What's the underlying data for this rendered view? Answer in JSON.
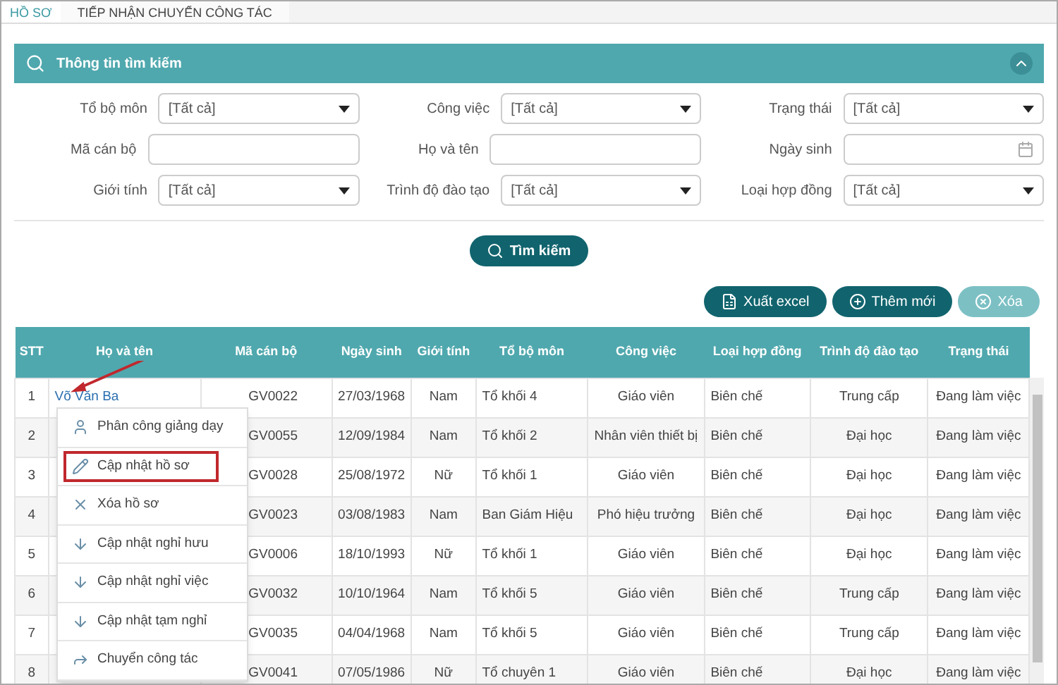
{
  "tabs": [
    {
      "label": "HỒ SƠ",
      "selected": true
    },
    {
      "label": "TIẾP NHẬN CHUYỂN CÔNG TÁC",
      "selected": false
    }
  ],
  "search_panel": {
    "title": "Thông tin tìm kiếm",
    "fields": [
      {
        "label": "Tổ bộ môn",
        "kind": "select",
        "value": "[Tất cả]"
      },
      {
        "label": "Công việc",
        "kind": "select",
        "value": "[Tất cả]"
      },
      {
        "label": "Trạng thái",
        "kind": "select",
        "value": "[Tất cả]"
      },
      {
        "label": "Mã cán bộ",
        "kind": "text"
      },
      {
        "label": "Họ và tên",
        "kind": "text"
      },
      {
        "label": "Ngày sinh",
        "kind": "date"
      },
      {
        "label": "Giới tính",
        "kind": "select",
        "value": "[Tất cả]"
      },
      {
        "label": "Trình độ đào tạo",
        "kind": "select",
        "value": "[Tất cả]"
      },
      {
        "label": "Loại hợp đồng",
        "kind": "select",
        "value": "[Tất cả]"
      }
    ],
    "search_button": "Tìm kiếm"
  },
  "actions": [
    {
      "label": "Xuất excel",
      "kind": "excel",
      "disabled": false
    },
    {
      "label": "Thêm mới",
      "kind": "add",
      "disabled": false
    },
    {
      "label": "Xóa",
      "kind": "delete",
      "disabled": true
    }
  ],
  "table": {
    "columns": [
      "STT",
      "Họ và tên",
      "Mã cán bộ",
      "Ngày sinh",
      "Giới tính",
      "Tổ bộ môn",
      "Công việc",
      "Loại hợp đồng",
      "Trình độ đào tạo",
      "Trạng thái"
    ],
    "rows": [
      [
        "1",
        "Võ Văn Ba",
        "GV0022",
        "27/03/1968",
        "Nam",
        "Tổ khối 4",
        "Giáo viên",
        "Biên chế",
        "Trung cấp",
        "Đang làm việc"
      ],
      [
        "2",
        "",
        "GV0055",
        "12/09/1984",
        "Nam",
        "Tổ khối 2",
        "Nhân viên thiết bị",
        "Biên chế",
        "Đại học",
        "Đang làm việc"
      ],
      [
        "3",
        "",
        "GV0028",
        "25/08/1972",
        "Nữ",
        "Tổ khối 1",
        "Giáo viên",
        "Biên chế",
        "Đại học",
        "Đang làm việc"
      ],
      [
        "4",
        "",
        "GV0023",
        "03/08/1983",
        "Nam",
        "Ban Giám Hiệu",
        "Phó hiệu trưởng",
        "Biên chế",
        "Đại học",
        "Đang làm việc"
      ],
      [
        "5",
        "",
        "GV0006",
        "18/10/1993",
        "Nữ",
        "Tổ khối 1",
        "Giáo viên",
        "Biên chế",
        "Đại học",
        "Đang làm việc"
      ],
      [
        "6",
        "",
        "GV0032",
        "10/10/1964",
        "Nam",
        "Tổ khối 5",
        "Giáo viên",
        "Biên chế",
        "Trung cấp",
        "Đang làm việc"
      ],
      [
        "7",
        "",
        "GV0035",
        "04/04/1968",
        "Nam",
        "Tổ khối 5",
        "Giáo viên",
        "Biên chế",
        "Trung cấp",
        "Đang làm việc"
      ],
      [
        "8",
        "",
        "GV0041",
        "07/05/1986",
        "Nữ",
        "Tổ chuyên 1",
        "Giáo viên",
        "Biên chế",
        "Đại học",
        "Đang làm việc"
      ]
    ]
  },
  "context_menu": [
    {
      "label": "Phân công giảng dạy",
      "kind": "person",
      "highlighted": false
    },
    {
      "label": "Cập nhật hồ sơ",
      "kind": "edit",
      "highlighted": true
    },
    {
      "label": "Xóa hồ sơ",
      "kind": "delete",
      "highlighted": false
    },
    {
      "label": "Cập nhật nghỉ hưu",
      "kind": "down",
      "highlighted": false
    },
    {
      "label": "Cập nhật nghỉ việc",
      "kind": "down",
      "highlighted": false
    },
    {
      "label": "Cập nhật tạm nghỉ",
      "kind": "down",
      "highlighted": false
    },
    {
      "label": "Chuyển công tác",
      "kind": "share",
      "highlighted": false
    }
  ]
}
